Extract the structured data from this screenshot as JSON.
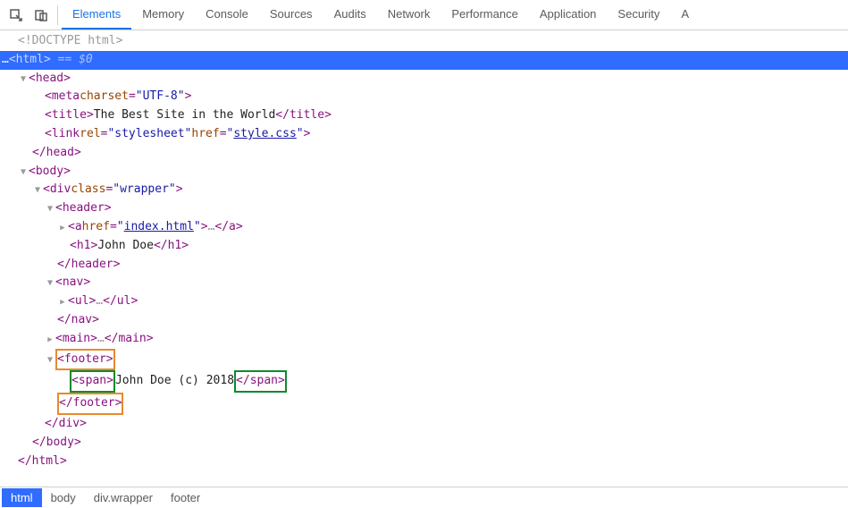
{
  "tabs": {
    "elements": "Elements",
    "memory": "Memory",
    "console": "Console",
    "sources": "Sources",
    "audits": "Audits",
    "network": "Network",
    "performance": "Performance",
    "application": "Application",
    "security": "Security",
    "more": "A"
  },
  "dom": {
    "doctype": "<!DOCTYPE html>",
    "html_open": "html",
    "eq0": " == $0",
    "head": "head",
    "meta_charset_attr": "charset",
    "meta_charset_val": "\"UTF-8\"",
    "meta_tag": "meta",
    "title_tag": "title",
    "title_text": "The Best Site in the World",
    "link_tag": "link",
    "link_rel_attr": "rel",
    "link_rel_val": "\"stylesheet\"",
    "link_href_attr": "href",
    "link_href_val": "style.css",
    "body": "body",
    "div": "div",
    "class_attr": "class",
    "wrapper_val": "\"wrapper\"",
    "header": "header",
    "a_tag": "a",
    "href_attr": "href",
    "index_val": "index.html",
    "h1_tag": "h1",
    "h1_text": "John Doe",
    "nav": "nav",
    "ul": "ul",
    "main": "main",
    "footer": "footer",
    "span": "span",
    "footer_text": "John Doe (c) 2018",
    "ellipsis": "…"
  },
  "breadcrumb": {
    "html": "html",
    "body": "body",
    "div": "div.wrapper",
    "footer": "footer"
  }
}
